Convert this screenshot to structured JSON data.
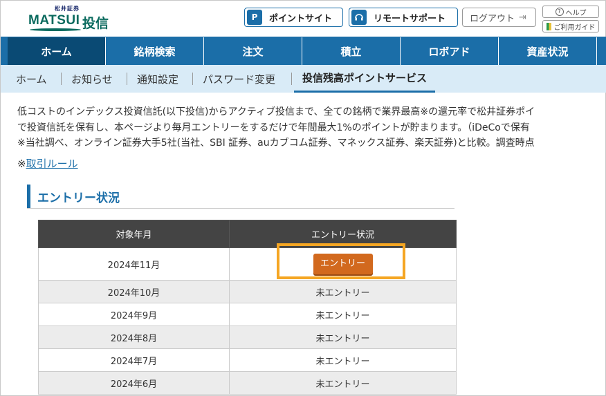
{
  "header": {
    "logo_small": "松井証券",
    "logo_brand": "MATSUI",
    "logo_brand2": "投信",
    "point_site_label": "ポイントサイト",
    "point_icon": "P",
    "remote_support_label": "リモートサポート",
    "logout_label": "ログアウト",
    "help_label": "ヘルプ",
    "guide_label": "ご利用ガイド"
  },
  "main_nav": [
    {
      "label": "ホーム",
      "active": true
    },
    {
      "label": "銘柄検索"
    },
    {
      "label": "注文"
    },
    {
      "label": "積立"
    },
    {
      "label": "ロボアド"
    },
    {
      "label": "資産状況"
    }
  ],
  "sub_nav": [
    {
      "label": "ホーム"
    },
    {
      "label": "お知らせ"
    },
    {
      "label": "通知設定"
    },
    {
      "label": "パスワード変更"
    },
    {
      "label": "投信残高ポイントサービス",
      "active": true
    }
  ],
  "intro": {
    "line1": "低コストのインデックス投資信託(以下投信)からアクティブ投信まで、全ての銘柄で業界最高※の還元率で松井証券ポイ",
    "line2": "で投資信託を保有し、本ページより毎月エントリーをするだけで年間最大1%のポイントが貯まります。（iDeCoで保有",
    "line3": "※当社調べ、オンライン証券大手5社(当社、SBI 証券、auカブコム証券、マネックス証券、楽天証券)と比較。調査時点",
    "rule_prefix": "※",
    "rule_link": "取引ルール"
  },
  "section_title": "エントリー状況",
  "table": {
    "headers": [
      "対象年月",
      "エントリー状況"
    ],
    "rows": [
      {
        "month": "2024年11月",
        "status": "エントリー",
        "is_button": true
      },
      {
        "month": "2024年10月",
        "status": "未エントリー"
      },
      {
        "month": "2024年9月",
        "status": "未エントリー"
      },
      {
        "month": "2024年8月",
        "status": "未エントリー"
      },
      {
        "month": "2024年7月",
        "status": "未エントリー"
      },
      {
        "month": "2024年6月",
        "status": "未エントリー"
      }
    ]
  },
  "colors": {
    "primary": "#1b6ea8",
    "nav_active": "#0a4a74",
    "subnav_bg": "#d9ebf7",
    "entry_button": "#d2691e",
    "highlight": "#f5a623"
  }
}
